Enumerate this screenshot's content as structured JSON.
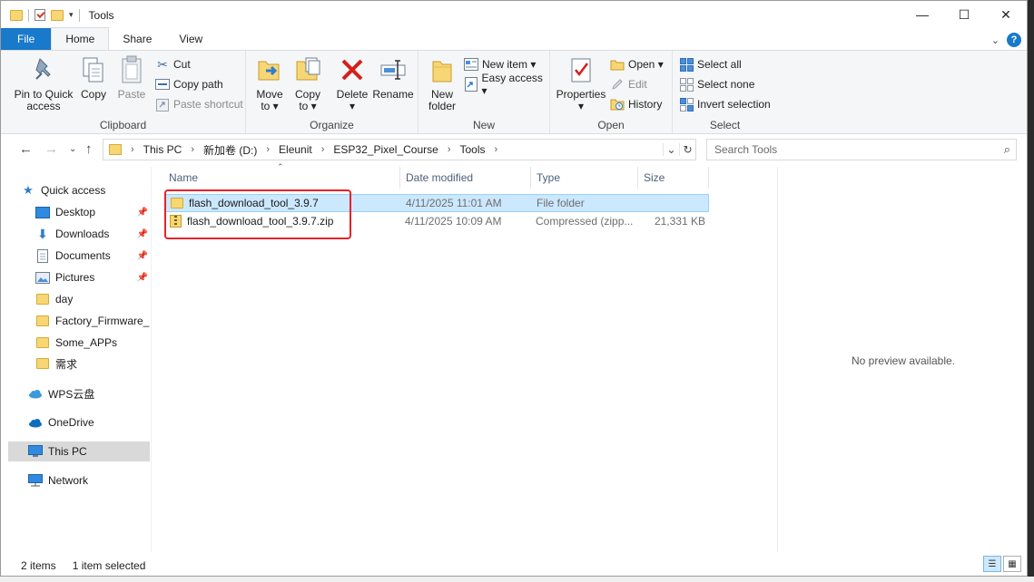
{
  "window": {
    "title": "Tools",
    "controls": {
      "minimize": "—",
      "maximize": "☐",
      "close": "✕"
    }
  },
  "tabs": {
    "file": "File",
    "home": "Home",
    "share": "Share",
    "view": "View"
  },
  "ribbon": {
    "clipboard": {
      "label": "Clipboard",
      "pin": "Pin to Quick access",
      "pin_l1": "Pin to Quick",
      "pin_l2": "access",
      "copy": "Copy",
      "paste": "Paste",
      "cut": "Cut",
      "copy_path": "Copy path",
      "paste_shortcut": "Paste shortcut"
    },
    "organize": {
      "label": "Organize",
      "move_to_l1": "Move",
      "move_to_l2": "to ▾",
      "copy_to_l1": "Copy",
      "copy_to_l2": "to ▾",
      "delete_l1": "Delete",
      "delete_l2": "▾",
      "rename": "Rename"
    },
    "new": {
      "label": "New",
      "new_folder_l1": "New",
      "new_folder_l2": "folder",
      "new_item": "New item ▾",
      "easy_access": "Easy access ▾"
    },
    "open": {
      "label": "Open",
      "properties_l1": "Properties",
      "properties_l2": "▾",
      "open": "Open ▾",
      "edit": "Edit",
      "history": "History"
    },
    "select": {
      "label": "Select",
      "select_all": "Select all",
      "select_none": "Select none",
      "invert": "Invert selection"
    }
  },
  "address": {
    "crumbs": [
      "This PC",
      "新加卷 (D:)",
      "Eleunit",
      "ESP32_Pixel_Course",
      "Tools"
    ],
    "search_placeholder": "Search Tools"
  },
  "nav": {
    "quick_access": "Quick access",
    "desktop": "Desktop",
    "downloads": "Downloads",
    "documents": "Documents",
    "pictures": "Pictures",
    "day": "day",
    "factory": "Factory_Firmware_b",
    "some_apps": "Some_APPs",
    "xuqiu": "需求",
    "wps": "WPS云盘",
    "onedrive": "OneDrive",
    "this_pc": "This PC",
    "network": "Network"
  },
  "columns": {
    "name": "Name",
    "date": "Date modified",
    "type": "Type",
    "size": "Size"
  },
  "files": [
    {
      "name": "flash_download_tool_3.9.7",
      "date": "4/11/2025 11:01 AM",
      "type": "File folder",
      "size": ""
    },
    {
      "name": "flash_download_tool_3.9.7.zip",
      "date": "4/11/2025 10:09 AM",
      "type": "Compressed (zipp...",
      "size": "21,331 KB"
    }
  ],
  "preview": {
    "text": "No preview available."
  },
  "status": {
    "items": "2 items",
    "selected": "1 item selected"
  },
  "colors": {
    "accent": "#1979ca",
    "selection": "#cce8ff",
    "highlight_box": "#e4232a"
  }
}
